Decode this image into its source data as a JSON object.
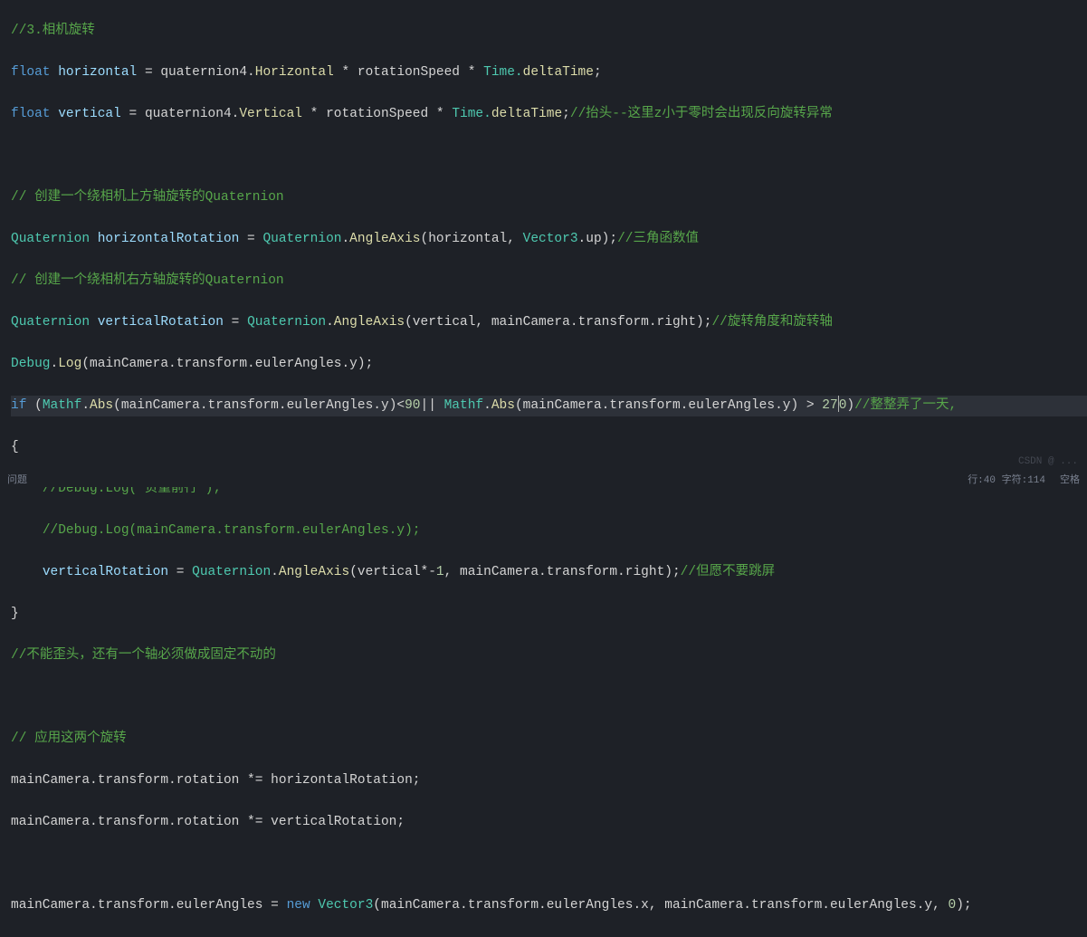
{
  "code": {
    "l1": "//3.相机旋转",
    "l2_kw": "float",
    "l2_var": " horizontal ",
    "l2_op": "= ",
    "l2_p1": "quaternion4.",
    "l2_prop1": "Horizontal",
    "l2_op2": " * ",
    "l2_p2": "rotationSpeed",
    "l2_op3": " * ",
    "l2_p3": "Time.",
    "l2_prop2": "deltaTime",
    "l2_end": ";",
    "l3_kw": "float",
    "l3_var": " vertical ",
    "l3_op": "= ",
    "l3_p1": "quaternion4.",
    "l3_prop1": "Vertical",
    "l3_op2": " * ",
    "l3_p2": "rotationSpeed",
    "l3_op3": " * ",
    "l3_p3": "Time.",
    "l3_prop2": "deltaTime",
    "l3_end": ";",
    "l3_comment": "//抬头--这里z小于零时会出现反向旋转异常",
    "l5": "// 创建一个绕相机上方轴旋转的Quaternion",
    "l6_type": "Quaternion",
    "l6_var": " horizontalRotation ",
    "l6_op": "= ",
    "l6_type2": "Quaternion",
    "l6_dot": ".",
    "l6_method": "AngleAxis",
    "l6_args": "(horizontal, ",
    "l6_type3": "Vector3",
    "l6_prop": ".up)",
    "l6_end": ";",
    "l6_comment": "//三角函数值",
    "l7": "// 创建一个绕相机右方轴旋转的Quaternion",
    "l8_type": "Quaternion",
    "l8_var": " verticalRotation ",
    "l8_op": "= ",
    "l8_type2": "Quaternion",
    "l8_dot": ".",
    "l8_method": "AngleAxis",
    "l8_args": "(vertical, mainCamera.transform.right)",
    "l8_end": ";",
    "l8_comment": "//旋转角度和旋转轴",
    "l9_type": "Debug",
    "l9_dot": ".",
    "l9_method": "Log",
    "l9_args": "(mainCamera.transform.eulerAngles.y)",
    "l9_end": ";",
    "l10_kw": "if",
    "l10_p1": " (",
    "l10_type": "Mathf",
    "l10_dot": ".",
    "l10_method": "Abs",
    "l10_args1": "(mainCamera.transform.eulerAngles.y)<",
    "l10_num1": "90",
    "l10_op": "|| ",
    "l10_type2": "Mathf",
    "l10_dot2": ".",
    "l10_method2": "Abs",
    "l10_args2": "(mainCamera.transform.eulerAngles.y) > ",
    "l10_num2": "27",
    "l10_num2b": "0",
    "l10_p2": ")",
    "l10_comment": "//整整弄了一天,",
    "l11": "{",
    "l12_pipe": "    ",
    "l12": "//Debug.Log(\"负重前行\");",
    "l13_pipe": "    ",
    "l13": "//Debug.Log(mainCamera.transform.eulerAngles.y);",
    "l14_pipe": "    ",
    "l14_var": "verticalRotation ",
    "l14_op": "= ",
    "l14_type": "Quaternion",
    "l14_dot": ".",
    "l14_method": "AngleAxis",
    "l14_args": "(vertical*-",
    "l14_num": "1",
    "l14_args2": ", mainCamera.transform.right)",
    "l14_end": ";",
    "l14_comment": "//但愿不要跳屏",
    "l15": "}",
    "l16": "//不能歪头，还有一个轴必须做成固定不动的",
    "l18": "// 应用这两个旋转",
    "l19_p1": "mainCamera.transform.rotation ",
    "l19_op": "*= ",
    "l19_p2": "horizontalRotation",
    "l19_end": ";",
    "l20_p1": "mainCamera.transform.rotation ",
    "l20_op": "*= ",
    "l20_p2": "verticalRotation",
    "l20_end": ";",
    "l22_p1": "mainCamera.transform.eulerAngles ",
    "l22_op": "= ",
    "l22_new": "new",
    "l22_sp": " ",
    "l22_type": "Vector3",
    "l22_args": "(mainCamera.transform.eulerAngles.x, mainCamera.transform.eulerAngles.y, ",
    "l22_num": "0",
    "l22_end": ");"
  },
  "status": {
    "left": "问题",
    "line_col": "行:40    字符:114",
    "encoding": "空格"
  },
  "watermark": "CSDN @ ..."
}
